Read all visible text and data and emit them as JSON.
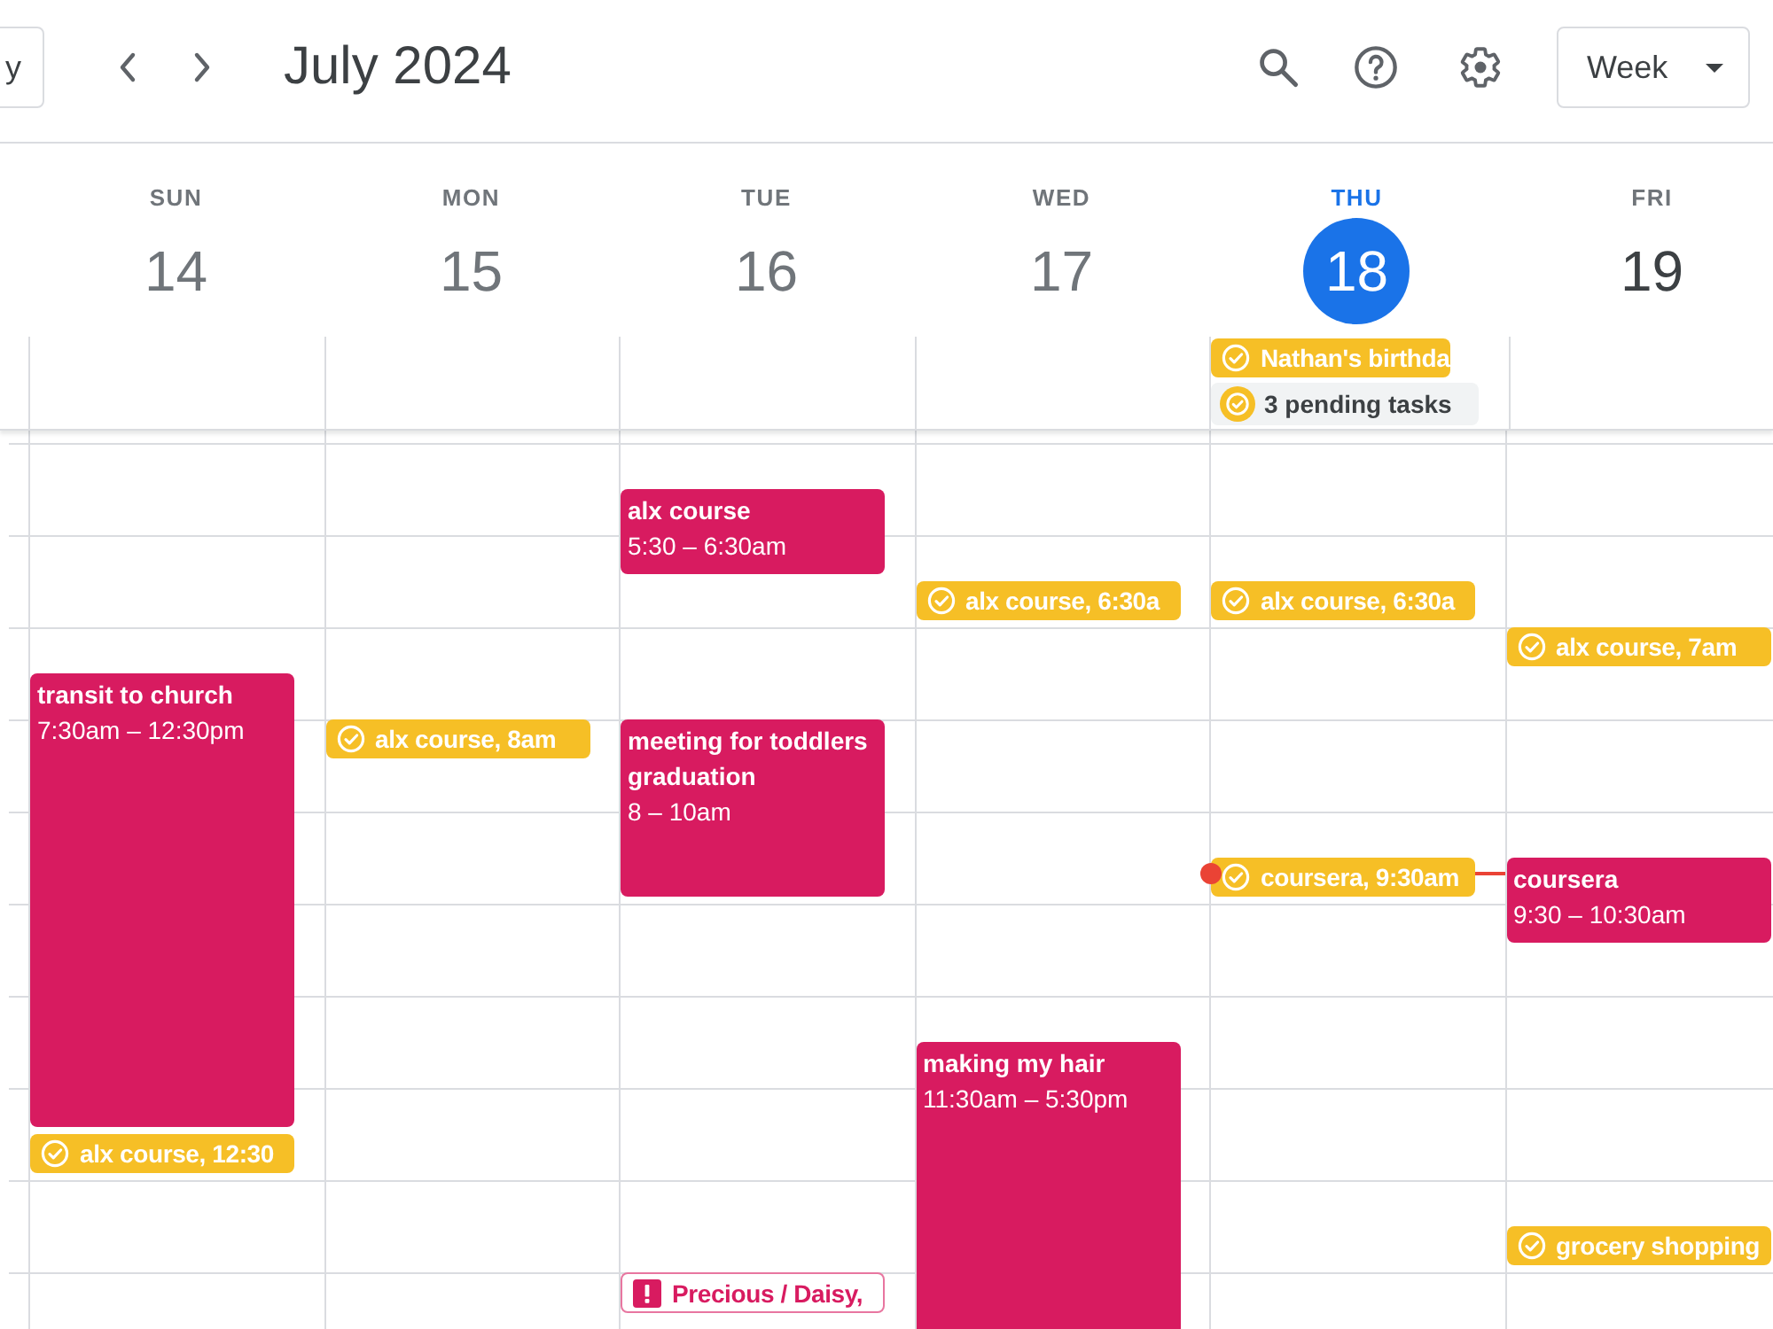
{
  "toolbar": {
    "today_button": "y",
    "title": "July 2024",
    "view_button": "Week"
  },
  "days": [
    {
      "name": "SUN",
      "number": "14",
      "past": true,
      "today": false,
      "events": [
        {
          "kind": "event",
          "title": "transit to church",
          "time": "7:30am – 12:30pm",
          "color": "#d81b60"
        },
        {
          "kind": "task",
          "title": "alx course, 12:30",
          "color": "#f6bf26"
        }
      ]
    },
    {
      "name": "MON",
      "number": "15",
      "past": true,
      "today": false,
      "events": [
        {
          "kind": "task",
          "title": "alx course, 8am",
          "color": "#f6bf26"
        }
      ]
    },
    {
      "name": "TUE",
      "number": "16",
      "past": true,
      "today": false,
      "events": [
        {
          "kind": "event",
          "title": "alx course",
          "time": "5:30 – 6:30am",
          "color": "#d81b60"
        },
        {
          "kind": "event",
          "title": "meeting for toddlers graduation",
          "time": "8 – 10am",
          "color": "#d81b60"
        },
        {
          "kind": "alert",
          "title": "Precious / Daisy,",
          "color": "#d81b60"
        }
      ]
    },
    {
      "name": "WED",
      "number": "17",
      "past": true,
      "today": false,
      "events": [
        {
          "kind": "task",
          "title": "alx course, 6:30a",
          "color": "#f6bf26"
        },
        {
          "kind": "event",
          "title": "making my hair",
          "time": "11:30am – 5:30pm",
          "color": "#d81b60"
        }
      ]
    },
    {
      "name": "THU",
      "number": "18",
      "past": false,
      "today": true,
      "all_day": [
        {
          "kind": "task",
          "title": "Nathan's birthda",
          "color": "#f6bf26"
        },
        {
          "kind": "pending",
          "title": "3 pending tasks"
        }
      ],
      "events": [
        {
          "kind": "task",
          "title": "alx course, 6:30a",
          "color": "#f6bf26"
        },
        {
          "kind": "task",
          "title": "coursera, 9:30am",
          "color": "#f6bf26"
        }
      ]
    },
    {
      "name": "FRI",
      "number": "19",
      "past": false,
      "today": false,
      "events": [
        {
          "kind": "task",
          "title": "alx course, 7am",
          "color": "#f6bf26"
        },
        {
          "kind": "event",
          "title": "coursera",
          "time": "9:30 – 10:30am",
          "color": "#d81b60"
        },
        {
          "kind": "task",
          "title": "grocery shopping",
          "color": "#f6bf26"
        }
      ]
    }
  ]
}
